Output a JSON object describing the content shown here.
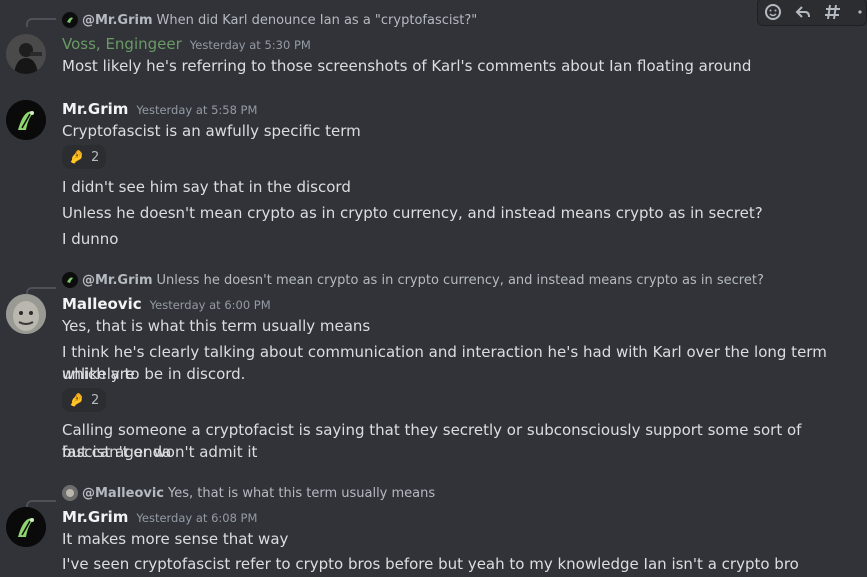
{
  "toolbar": {
    "icons": [
      "add-reaction-icon",
      "reply-icon",
      "create-thread-icon",
      "more-icon"
    ]
  },
  "messages": [
    {
      "reply": {
        "author": "@Mr.Grim",
        "text": "When did Karl denounce Ian as a \"cryptofascist?\""
      },
      "author": "Voss, Engingeer",
      "timestamp": "Yesterday at 5:30 PM",
      "lines": [
        "Most likely he's referring to those screenshots of Karl's comments about Ian floating around"
      ]
    },
    {
      "author": "Mr.Grim",
      "timestamp": "Yesterday at 5:58 PM",
      "lines": [
        "Cryptofascist is an awfully specific term",
        "I didn't see him say that in the discord",
        "Unless he doesn't mean crypto as in crypto currency, and instead means crypto as in secret?",
        "I dunno"
      ],
      "reaction": {
        "emoji": "🤌",
        "count": "2"
      }
    },
    {
      "reply": {
        "author": "@Mr.Grim",
        "text": "Unless he doesn't mean crypto as in crypto currency, and instead means crypto as in secret?"
      },
      "author": "Malleovic",
      "timestamp": "Yesterday at 6:00 PM",
      "lines": [
        "Yes, that is what this term usually means",
        "I think he's clearly talking about communication and interaction he's had with Karl over the long term which are",
        "unlikely to be in discord.",
        "Calling someone a cryptofacist is saying that they secretly or subconsciously support some sort of fascist agenda",
        "but can't or won't admit it"
      ],
      "reaction": {
        "emoji": "🤌",
        "count": "2"
      }
    },
    {
      "reply": {
        "author": "@Malleovic",
        "text": "Yes, that is what this term usually means"
      },
      "author": "Mr.Grim",
      "timestamp": "Yesterday at 6:08 PM",
      "lines": [
        "It makes more sense that way",
        "I've seen cryptofascist refer to crypto bros before but yeah to my knowledge Ian isn't a crypto bro"
      ]
    }
  ]
}
